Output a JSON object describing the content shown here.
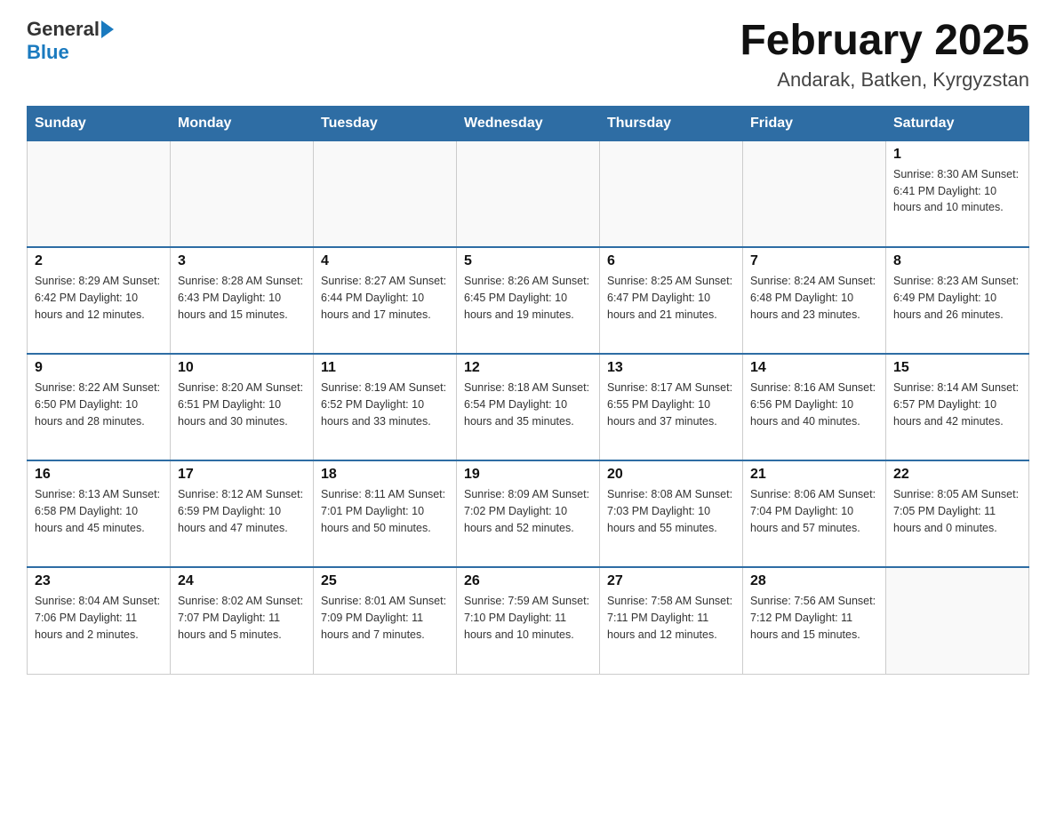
{
  "header": {
    "logo_general": "General",
    "logo_blue": "Blue",
    "month_title": "February 2025",
    "location": "Andarak, Batken, Kyrgyzstan"
  },
  "weekdays": [
    "Sunday",
    "Monday",
    "Tuesday",
    "Wednesday",
    "Thursday",
    "Friday",
    "Saturday"
  ],
  "weeks": [
    [
      {
        "day": "",
        "info": ""
      },
      {
        "day": "",
        "info": ""
      },
      {
        "day": "",
        "info": ""
      },
      {
        "day": "",
        "info": ""
      },
      {
        "day": "",
        "info": ""
      },
      {
        "day": "",
        "info": ""
      },
      {
        "day": "1",
        "info": "Sunrise: 8:30 AM\nSunset: 6:41 PM\nDaylight: 10 hours and 10 minutes."
      }
    ],
    [
      {
        "day": "2",
        "info": "Sunrise: 8:29 AM\nSunset: 6:42 PM\nDaylight: 10 hours and 12 minutes."
      },
      {
        "day": "3",
        "info": "Sunrise: 8:28 AM\nSunset: 6:43 PM\nDaylight: 10 hours and 15 minutes."
      },
      {
        "day": "4",
        "info": "Sunrise: 8:27 AM\nSunset: 6:44 PM\nDaylight: 10 hours and 17 minutes."
      },
      {
        "day": "5",
        "info": "Sunrise: 8:26 AM\nSunset: 6:45 PM\nDaylight: 10 hours and 19 minutes."
      },
      {
        "day": "6",
        "info": "Sunrise: 8:25 AM\nSunset: 6:47 PM\nDaylight: 10 hours and 21 minutes."
      },
      {
        "day": "7",
        "info": "Sunrise: 8:24 AM\nSunset: 6:48 PM\nDaylight: 10 hours and 23 minutes."
      },
      {
        "day": "8",
        "info": "Sunrise: 8:23 AM\nSunset: 6:49 PM\nDaylight: 10 hours and 26 minutes."
      }
    ],
    [
      {
        "day": "9",
        "info": "Sunrise: 8:22 AM\nSunset: 6:50 PM\nDaylight: 10 hours and 28 minutes."
      },
      {
        "day": "10",
        "info": "Sunrise: 8:20 AM\nSunset: 6:51 PM\nDaylight: 10 hours and 30 minutes."
      },
      {
        "day": "11",
        "info": "Sunrise: 8:19 AM\nSunset: 6:52 PM\nDaylight: 10 hours and 33 minutes."
      },
      {
        "day": "12",
        "info": "Sunrise: 8:18 AM\nSunset: 6:54 PM\nDaylight: 10 hours and 35 minutes."
      },
      {
        "day": "13",
        "info": "Sunrise: 8:17 AM\nSunset: 6:55 PM\nDaylight: 10 hours and 37 minutes."
      },
      {
        "day": "14",
        "info": "Sunrise: 8:16 AM\nSunset: 6:56 PM\nDaylight: 10 hours and 40 minutes."
      },
      {
        "day": "15",
        "info": "Sunrise: 8:14 AM\nSunset: 6:57 PM\nDaylight: 10 hours and 42 minutes."
      }
    ],
    [
      {
        "day": "16",
        "info": "Sunrise: 8:13 AM\nSunset: 6:58 PM\nDaylight: 10 hours and 45 minutes."
      },
      {
        "day": "17",
        "info": "Sunrise: 8:12 AM\nSunset: 6:59 PM\nDaylight: 10 hours and 47 minutes."
      },
      {
        "day": "18",
        "info": "Sunrise: 8:11 AM\nSunset: 7:01 PM\nDaylight: 10 hours and 50 minutes."
      },
      {
        "day": "19",
        "info": "Sunrise: 8:09 AM\nSunset: 7:02 PM\nDaylight: 10 hours and 52 minutes."
      },
      {
        "day": "20",
        "info": "Sunrise: 8:08 AM\nSunset: 7:03 PM\nDaylight: 10 hours and 55 minutes."
      },
      {
        "day": "21",
        "info": "Sunrise: 8:06 AM\nSunset: 7:04 PM\nDaylight: 10 hours and 57 minutes."
      },
      {
        "day": "22",
        "info": "Sunrise: 8:05 AM\nSunset: 7:05 PM\nDaylight: 11 hours and 0 minutes."
      }
    ],
    [
      {
        "day": "23",
        "info": "Sunrise: 8:04 AM\nSunset: 7:06 PM\nDaylight: 11 hours and 2 minutes."
      },
      {
        "day": "24",
        "info": "Sunrise: 8:02 AM\nSunset: 7:07 PM\nDaylight: 11 hours and 5 minutes."
      },
      {
        "day": "25",
        "info": "Sunrise: 8:01 AM\nSunset: 7:09 PM\nDaylight: 11 hours and 7 minutes."
      },
      {
        "day": "26",
        "info": "Sunrise: 7:59 AM\nSunset: 7:10 PM\nDaylight: 11 hours and 10 minutes."
      },
      {
        "day": "27",
        "info": "Sunrise: 7:58 AM\nSunset: 7:11 PM\nDaylight: 11 hours and 12 minutes."
      },
      {
        "day": "28",
        "info": "Sunrise: 7:56 AM\nSunset: 7:12 PM\nDaylight: 11 hours and 15 minutes."
      },
      {
        "day": "",
        "info": ""
      }
    ]
  ]
}
